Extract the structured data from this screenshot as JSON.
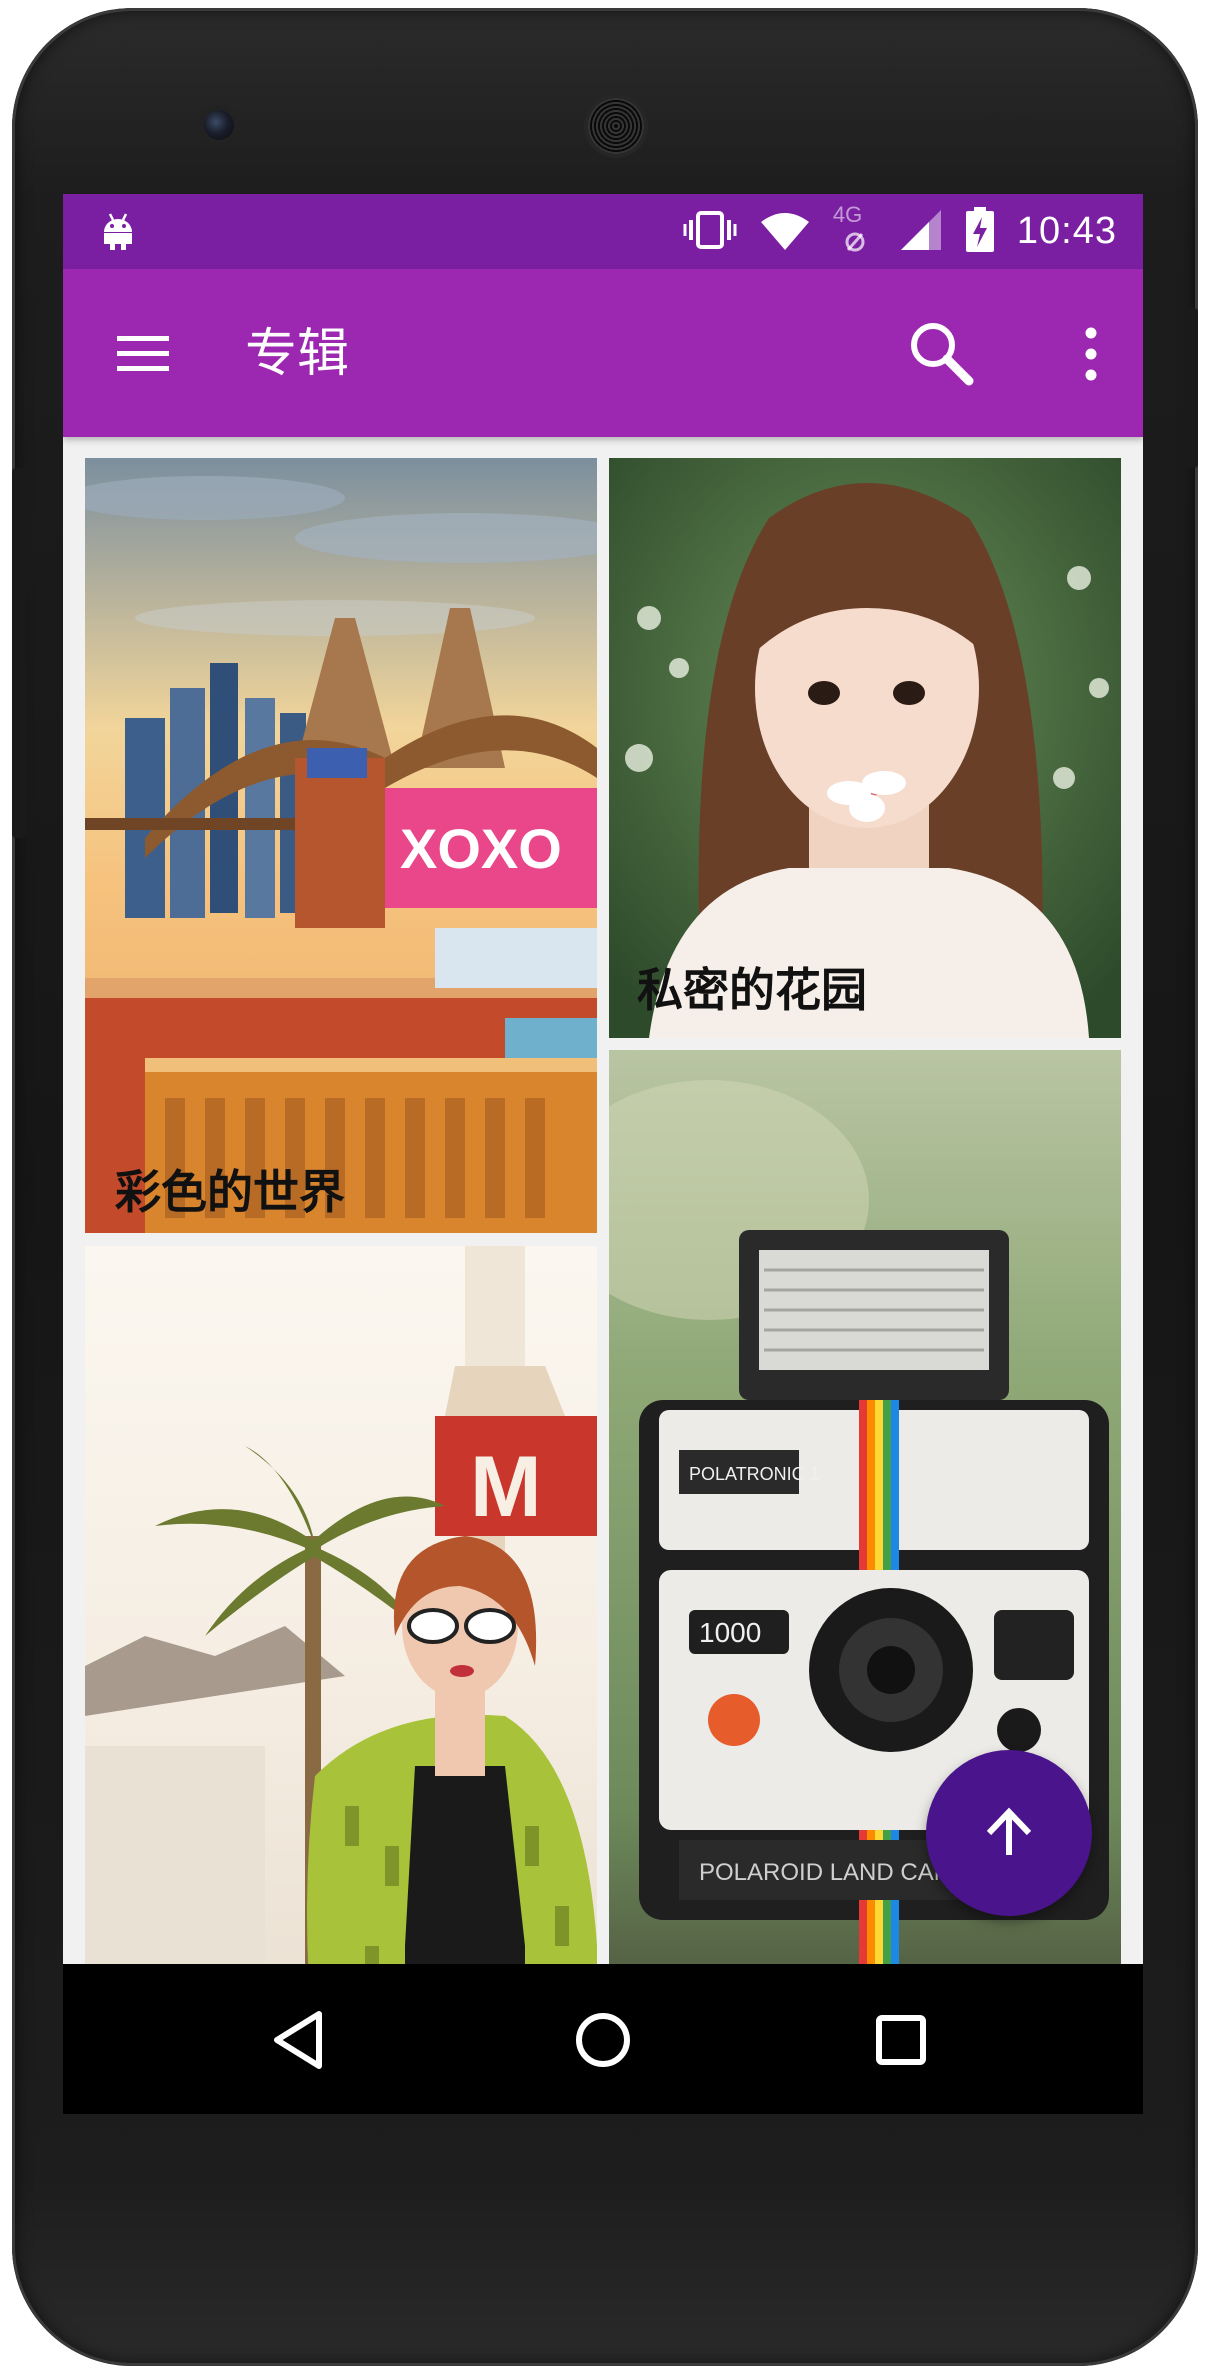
{
  "status_bar": {
    "time": "10:43",
    "network_label": "4G",
    "icons": [
      "android-notification-icon",
      "vibrate-icon",
      "wifi-icon",
      "mobile-data-off-icon",
      "signal-icon",
      "battery-charging-icon"
    ]
  },
  "toolbar": {
    "title": "专辑",
    "icons": [
      "menu-icon",
      "search-icon",
      "more-vert-icon"
    ],
    "background": "#9c27b0"
  },
  "albums": [
    {
      "caption": "彩色的世界"
    },
    {
      "caption": "私密的花园"
    },
    {
      "caption": ""
    },
    {
      "caption": ""
    }
  ],
  "fab": {
    "icon": "arrow-up-icon",
    "color": "#4a148c"
  },
  "navigation": {
    "icons": [
      "back-icon",
      "home-icon",
      "recents-icon"
    ]
  },
  "colors": {
    "status_bar": "#7b1fa2",
    "screen_background": "#f1f1f1"
  }
}
